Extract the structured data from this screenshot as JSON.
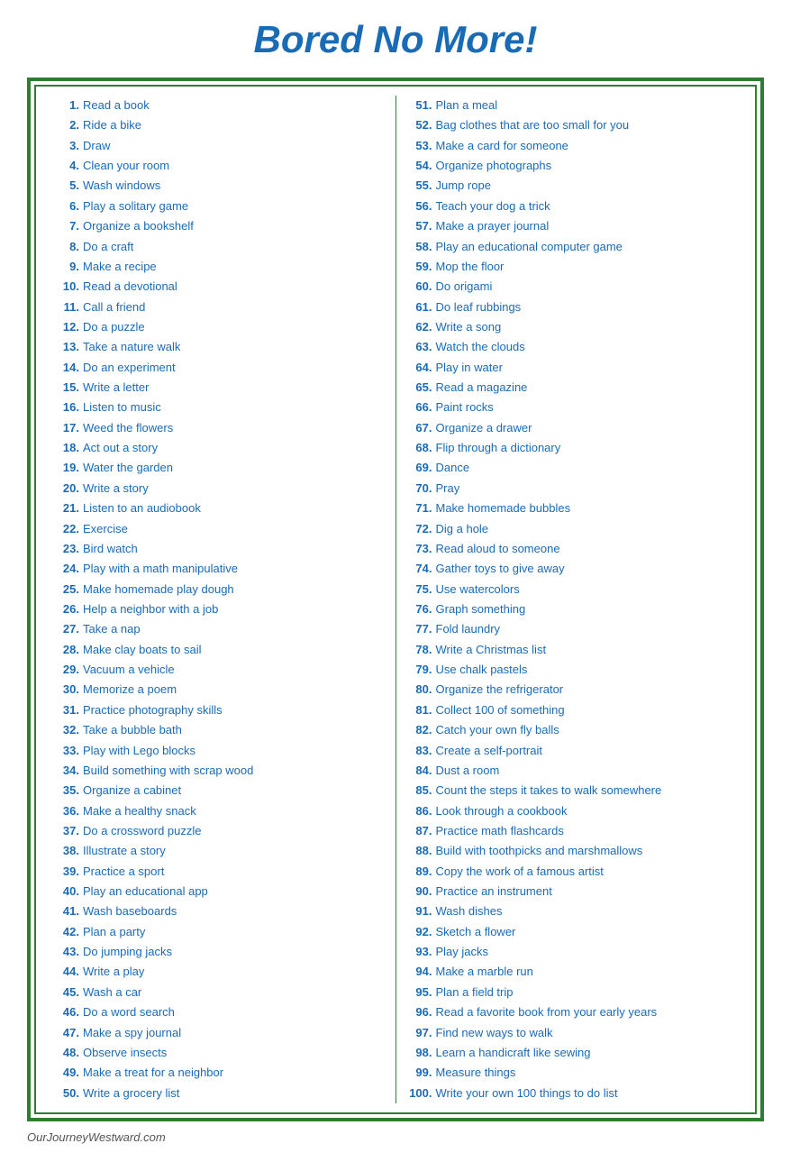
{
  "title": "Bored No More!",
  "footer": "OurJourneyWestward.com",
  "left_items": [
    "Read a book",
    "Ride a bike",
    "Draw",
    "Clean your room",
    "Wash windows",
    "Play a solitary game",
    "Organize a bookshelf",
    "Do a craft",
    "Make a recipe",
    "Read a devotional",
    "Call a friend",
    "Do a puzzle",
    "Take a nature walk",
    "Do an experiment",
    "Write a letter",
    "Listen to music",
    "Weed the flowers",
    "Act out a story",
    "Water the garden",
    "Write a story",
    "Listen to an audiobook",
    "Exercise",
    "Bird watch",
    "Play with a math manipulative",
    "Make homemade play dough",
    "Help a neighbor with a job",
    "Take a nap",
    "Make clay boats to sail",
    "Vacuum a vehicle",
    "Memorize a poem",
    "Practice photography skills",
    "Take a bubble bath",
    "Play with Lego blocks",
    "Build something with scrap wood",
    "Organize a cabinet",
    "Make a healthy snack",
    "Do a crossword puzzle",
    "Illustrate a story",
    "Practice a sport",
    "Play an educational app",
    "Wash baseboards",
    "Plan a party",
    "Do jumping jacks",
    "Write a play",
    "Wash a car",
    "Do a word search",
    "Make a spy journal",
    "Observe insects",
    "Make a treat for a neighbor",
    "Write a grocery list"
  ],
  "right_items": [
    "Plan a meal",
    "Bag clothes that are too small for you",
    "Make a card for someone",
    "Organize photographs",
    "Jump rope",
    "Teach your dog a trick",
    "Make a prayer journal",
    "Play an educational computer game",
    "Mop the floor",
    "Do origami",
    "Do leaf rubbings",
    "Write a song",
    "Watch the clouds",
    "Play in water",
    "Read a magazine",
    "Paint rocks",
    "Organize a drawer",
    "Flip through a dictionary",
    "Dance",
    "Pray",
    "Make homemade bubbles",
    "Dig a hole",
    "Read aloud to someone",
    "Gather toys to give away",
    "Use watercolors",
    "Graph something",
    "Fold laundry",
    "Write a Christmas list",
    "Use chalk pastels",
    "Organize the refrigerator",
    "Collect 100 of something",
    "Catch your own fly balls",
    "Create a self-portrait",
    "Dust a room",
    "Count the steps it takes to walk somewhere",
    "Look through a cookbook",
    "Practice math flashcards",
    "Build with toothpicks and marshmallows",
    "Copy the work of a famous artist",
    "Practice an instrument",
    "Wash dishes",
    "Sketch a flower",
    "Play jacks",
    "Make a marble run",
    "Plan a field trip",
    "Read a favorite book from your early years",
    "Find new ways to walk",
    "Learn a handicraft like sewing",
    "Measure things",
    "Write your own 100 things to do list"
  ]
}
